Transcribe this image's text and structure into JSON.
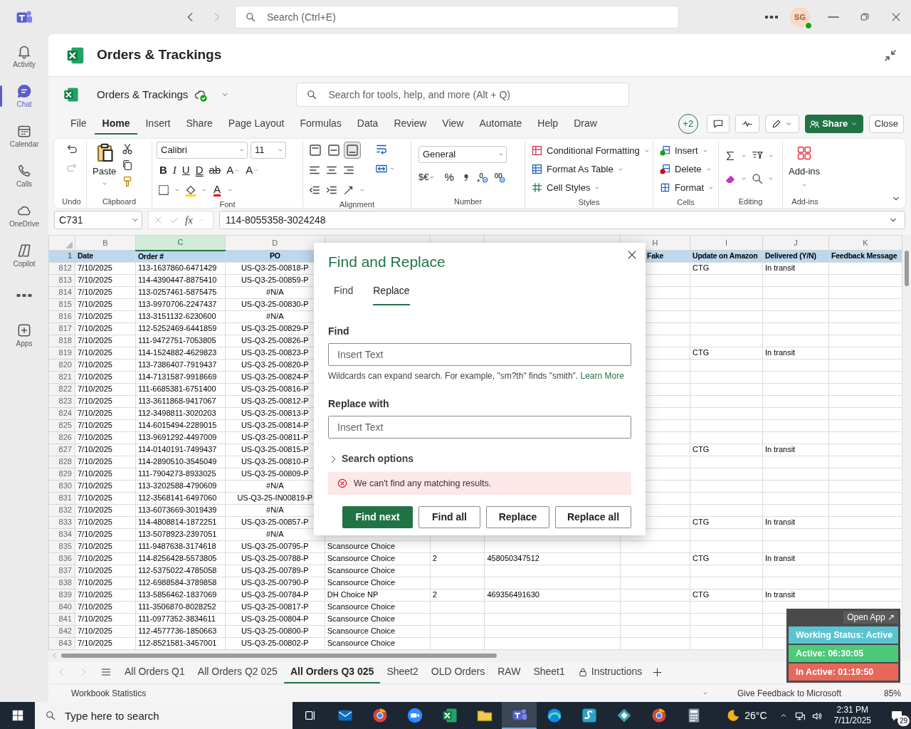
{
  "teams": {
    "search_placeholder": "Search (Ctrl+E)",
    "avatar": "SG",
    "rail": [
      {
        "kind": "bell",
        "label": "Activity",
        "selected": false
      },
      {
        "kind": "chat",
        "label": "Chat",
        "selected": true
      },
      {
        "kind": "calendar",
        "label": "Calendar",
        "selected": false
      },
      {
        "kind": "phone",
        "label": "Calls",
        "selected": false
      },
      {
        "kind": "cloud",
        "label": "OneDrive",
        "selected": false
      },
      {
        "kind": "copilot",
        "label": "Copilot",
        "selected": false
      },
      {
        "kind": "more",
        "selected": false
      },
      {
        "kind": "apps",
        "label": "Apps",
        "selected": false
      }
    ]
  },
  "app_title": "Orders & Trackings",
  "excel": {
    "file_name": "Orders & Trackings",
    "search_placeholder": "Search for tools, help, and more (Alt + Q)",
    "menu": [
      {
        "label": "File",
        "selected": false
      },
      {
        "label": "Home",
        "selected": true
      },
      {
        "label": "Insert",
        "selected": false
      },
      {
        "label": "Share",
        "selected": false
      },
      {
        "label": "Page Layout",
        "selected": false
      },
      {
        "label": "Formulas",
        "selected": false
      },
      {
        "label": "Data",
        "selected": false
      },
      {
        "label": "Review",
        "selected": false
      },
      {
        "label": "View",
        "selected": false
      },
      {
        "label": "Automate",
        "selected": false
      },
      {
        "label": "Help",
        "selected": false
      },
      {
        "label": "Draw",
        "selected": false
      }
    ],
    "collaborators": "+2",
    "share": "Share",
    "close": "Close",
    "ribbon": [
      {
        "kind": "undo",
        "label": "Undo",
        "redo_disabled": true
      },
      {
        "kind": "clipboard",
        "label": "Clipboard",
        "paste": "Paste"
      },
      {
        "kind": "font",
        "label": "Font",
        "font": "Calibri",
        "size": "11",
        "styles": [
          {
            "kind": "bold",
            "glyph": "B"
          },
          {
            "kind": "italic",
            "glyph": "I"
          },
          {
            "kind": "underline",
            "glyph": "U"
          },
          {
            "kind": "double_underline",
            "glyph": "D"
          },
          {
            "kind": "strikethrough",
            "glyph": "ab"
          },
          {
            "kind": "grow",
            "glyph": "A"
          },
          {
            "kind": "shrink",
            "glyph": "A"
          }
        ],
        "font_color_glyph": "A"
      },
      {
        "kind": "alignment",
        "label": "Alignment",
        "vertical": [
          {
            "selected": false
          },
          {
            "selected": false
          },
          {
            "selected": true
          }
        ]
      },
      {
        "kind": "number",
        "label": "Number",
        "format": "General",
        "currency": "$€",
        "percent": "%"
      },
      {
        "kind": "styles",
        "label": "Styles",
        "commands": [
          "Conditional Formatting",
          "Format As Table",
          "Cell Styles"
        ]
      },
      {
        "kind": "cells",
        "label": "Cells",
        "commands": [
          "Insert",
          "Delete",
          "Format"
        ]
      },
      {
        "kind": "editing",
        "label": "Editing"
      },
      {
        "kind": "addins",
        "label": "Add-ins",
        "command": "Add-ins"
      }
    ],
    "name_box": "C731",
    "function_glyph": "fx",
    "formula": "114-8055358-3024248"
  },
  "sheet": {
    "columns": [
      {
        "letter": "B",
        "selected": false
      },
      {
        "letter": "C",
        "selected": true
      },
      {
        "letter": "D",
        "selected": false
      },
      {
        "selected": false
      },
      {
        "selected": false
      },
      {
        "selected": false
      },
      {
        "letter": "H",
        "selected": false
      },
      {
        "letter": "I",
        "selected": false
      },
      {
        "letter": "J",
        "selected": false
      },
      {
        "letter": "K",
        "selected": false
      }
    ],
    "header_row": {
      "num": "1",
      "date": "Date",
      "order": "Order #",
      "po": "PO",
      "fake": "Fake",
      "update_on_amazon": "Update on Amazon",
      "delivered": "Delivered (Y/N)",
      "feedback_message": "Feedback Message"
    },
    "rows": [
      {
        "num": "812",
        "date": "7/10/2025",
        "order": "113-1637860-6471429",
        "po": "US-Q3-25-00818-P",
        "update_on_amazon": "CTG",
        "delivered": "In transit"
      },
      {
        "num": "813",
        "date": "7/10/2025",
        "order": "114-4390447-8875410",
        "po": "US-Q3-25-00859-P"
      },
      {
        "num": "814",
        "date": "7/10/2025",
        "order": "113-0257461-5875475",
        "po": "#N/A"
      },
      {
        "num": "815",
        "date": "7/10/2025",
        "order": "113-9970706-2247437",
        "po": "US-Q3-25-00830-P"
      },
      {
        "num": "816",
        "date": "7/10/2025",
        "order": "113-3151132-6230600",
        "po": "#N/A"
      },
      {
        "num": "817",
        "date": "7/10/2025",
        "order": "112-5252469-6441859",
        "po": "US-Q3-25-00829-P"
      },
      {
        "num": "818",
        "date": "7/10/2025",
        "order": "111-9472751-7053805",
        "po": "US-Q3-25-00826-P"
      },
      {
        "num": "819",
        "date": "7/10/2025",
        "order": "114-1524882-4629823",
        "po": "US-Q3-25-00823-P",
        "update_on_amazon": "CTG",
        "delivered": "In transit"
      },
      {
        "num": "820",
        "date": "7/10/2025",
        "order": "113-7386407-7919437",
        "po": "US-Q3-25-00820-P"
      },
      {
        "num": "821",
        "date": "7/10/2025",
        "order": "114-7131587-9918669",
        "po": "US-Q3-25-00824-P"
      },
      {
        "num": "822",
        "date": "7/10/2025",
        "order": "111-6685381-6751400",
        "po": "US-Q3-25-00816-P"
      },
      {
        "num": "823",
        "date": "7/10/2025",
        "order": "113-3611868-9417067",
        "po": "US-Q3-25-00812-P"
      },
      {
        "num": "824",
        "date": "7/10/2025",
        "order": "112-3498811-3020203",
        "po": "US-Q3-25-00813-P"
      },
      {
        "num": "825",
        "date": "7/10/2025",
        "order": "114-6015494-2289015",
        "po": "US-Q3-25-00814-P"
      },
      {
        "num": "826",
        "date": "7/10/2025",
        "order": "113-9691292-4497009",
        "po": "US-Q3-25-00811-P"
      },
      {
        "num": "827",
        "date": "7/10/2025",
        "order": "114-0140191-7499437",
        "po": "US-Q3-25-00815-P",
        "update_on_amazon": "CTG",
        "delivered": "In transit"
      },
      {
        "num": "828",
        "date": "7/10/2025",
        "order": "114-2890510-3545049",
        "po": "US-Q3-25-00810-P"
      },
      {
        "num": "829",
        "date": "7/10/2025",
        "order": "111-7904273-8933025",
        "po": "US-Q3-25-00809-P"
      },
      {
        "num": "830",
        "date": "7/10/2025",
        "order": "113-3202588-4790609",
        "po": "#N/A"
      },
      {
        "num": "831",
        "date": "7/10/2025",
        "order": "112-3568141-6497060",
        "po": "US-Q3-25-IN00819-P"
      },
      {
        "num": "832",
        "date": "7/10/2025",
        "order": "113-6073669-3019439",
        "po": "#N/A"
      },
      {
        "num": "833",
        "date": "7/10/2025",
        "order": "114-4808814-1872251",
        "po": "US-Q3-25-00857-P",
        "update_on_amazon": "CTG",
        "delivered": "In transit"
      },
      {
        "num": "834",
        "date": "7/10/2025",
        "order": "113-5078923-2397051",
        "po": "#N/A"
      },
      {
        "num": "835",
        "date": "7/10/2025",
        "order": "111-9487638-3174618",
        "po": "US-Q3-25-00795-P",
        "column_e": "Scansource Choice"
      },
      {
        "num": "836",
        "date": "7/10/2025",
        "order": "114-8256428-5573805",
        "po": "US-Q3-25-00788-P",
        "column_e": "Scansource Choice",
        "column_f": "2",
        "column_g": "458050347512",
        "update_on_amazon": "CTG",
        "delivered": "In transit"
      },
      {
        "num": "837",
        "date": "7/10/2025",
        "order": "112-5375022-4785058",
        "po": "US-Q3-25-00789-P",
        "column_e": "Scansource Choice"
      },
      {
        "num": "838",
        "date": "7/10/2025",
        "order": "112-6988584-3789858",
        "po": "US-Q3-25-00790-P",
        "column_e": "Scansource Choice"
      },
      {
        "num": "839",
        "date": "7/10/2025",
        "order": "113-5856462-1837069",
        "po": "US-Q3-25-00784-P",
        "column_e": "DH Choice NP",
        "column_f": "2",
        "column_g": "469356491630",
        "update_on_amazon": "CTG",
        "delivered": "In transit"
      },
      {
        "num": "840",
        "date": "7/10/2025",
        "order": "111-3506870-8028252",
        "po": "US-Q3-25-00817-P",
        "column_e": "Scansource Choice"
      },
      {
        "num": "841",
        "date": "7/10/2025",
        "order": "111-0977352-3834611",
        "po": "US-Q3-25-00804-P",
        "column_e": "Scansource Choice"
      },
      {
        "num": "842",
        "date": "7/10/2025",
        "order": "112-4577736-1850663",
        "po": "US-Q3-25-00800-P",
        "column_e": "Scansource Choice"
      },
      {
        "num": "843",
        "date": "7/10/2025",
        "order": "112-8521581-3457001",
        "po": "US-Q3-25-00802-P",
        "column_e": "Scansource Choice"
      }
    ],
    "tabs": [
      {
        "label": "All Orders Q1",
        "selected": false
      },
      {
        "label": "All Orders Q2 025",
        "selected": false
      },
      {
        "label": "All Orders Q3 025",
        "selected": true
      },
      {
        "label": "Sheet2",
        "selected": false
      },
      {
        "label": "OLD Orders",
        "selected": false
      },
      {
        "label": "RAW",
        "selected": false
      },
      {
        "label": "Sheet1",
        "selected": false
      },
      {
        "label": "Instructions",
        "selected": false,
        "locked": true
      }
    ],
    "status_bar": {
      "left": "Workbook Statistics",
      "feedback": "Give Feedback to Microsoft",
      "zoom": "85%"
    }
  },
  "dialog": {
    "title": "Find and Replace",
    "tabs": [
      {
        "label": "Find",
        "selected": false
      },
      {
        "label": "Replace",
        "selected": true
      }
    ],
    "find_label": "Find",
    "find_placeholder": "Insert Text",
    "hint": "Wildcards can expand search. For example, \"sm?th\" finds \"smith\".",
    "learn_more": "Learn More",
    "replace_label": "Replace with",
    "replace_placeholder": "Insert Text",
    "search_options": {
      "label": "Search options",
      "expanded": false
    },
    "error": "We can't find any matching results.",
    "buttons": [
      {
        "label": "Find next",
        "primary": true
      },
      {
        "label": "Find all",
        "primary": false
      },
      {
        "label": "Replace",
        "primary": false
      },
      {
        "label": "Replace all",
        "primary": false
      }
    ]
  },
  "tracker": {
    "open_app": "Open App ↗",
    "bars": [
      {
        "kind": "status",
        "text": "Working Status: Active"
      },
      {
        "kind": "active",
        "text": "Active: 06:30:05"
      },
      {
        "kind": "inactive",
        "text": "In Active: 01:19:50"
      }
    ]
  },
  "taskbar": {
    "search_placeholder": "Type here to search",
    "apps": [
      {
        "kind": "mail",
        "selected": false
      },
      {
        "kind": "browser",
        "selected": false
      },
      {
        "kind": "video",
        "selected": false
      },
      {
        "kind": "spreadsheet",
        "selected": false
      },
      {
        "kind": "folder",
        "selected": false
      },
      {
        "kind": "chat",
        "selected": true
      },
      {
        "kind": "globe",
        "selected": false
      },
      {
        "kind": "s_app",
        "selected": false
      },
      {
        "kind": "diamond",
        "selected": false
      },
      {
        "kind": "browser",
        "selected": false
      },
      {
        "kind": "calculator",
        "selected": false
      }
    ],
    "temperature": "26°C",
    "time": "2:31 PM",
    "date": "7/11/2025",
    "notifications": "29"
  }
}
